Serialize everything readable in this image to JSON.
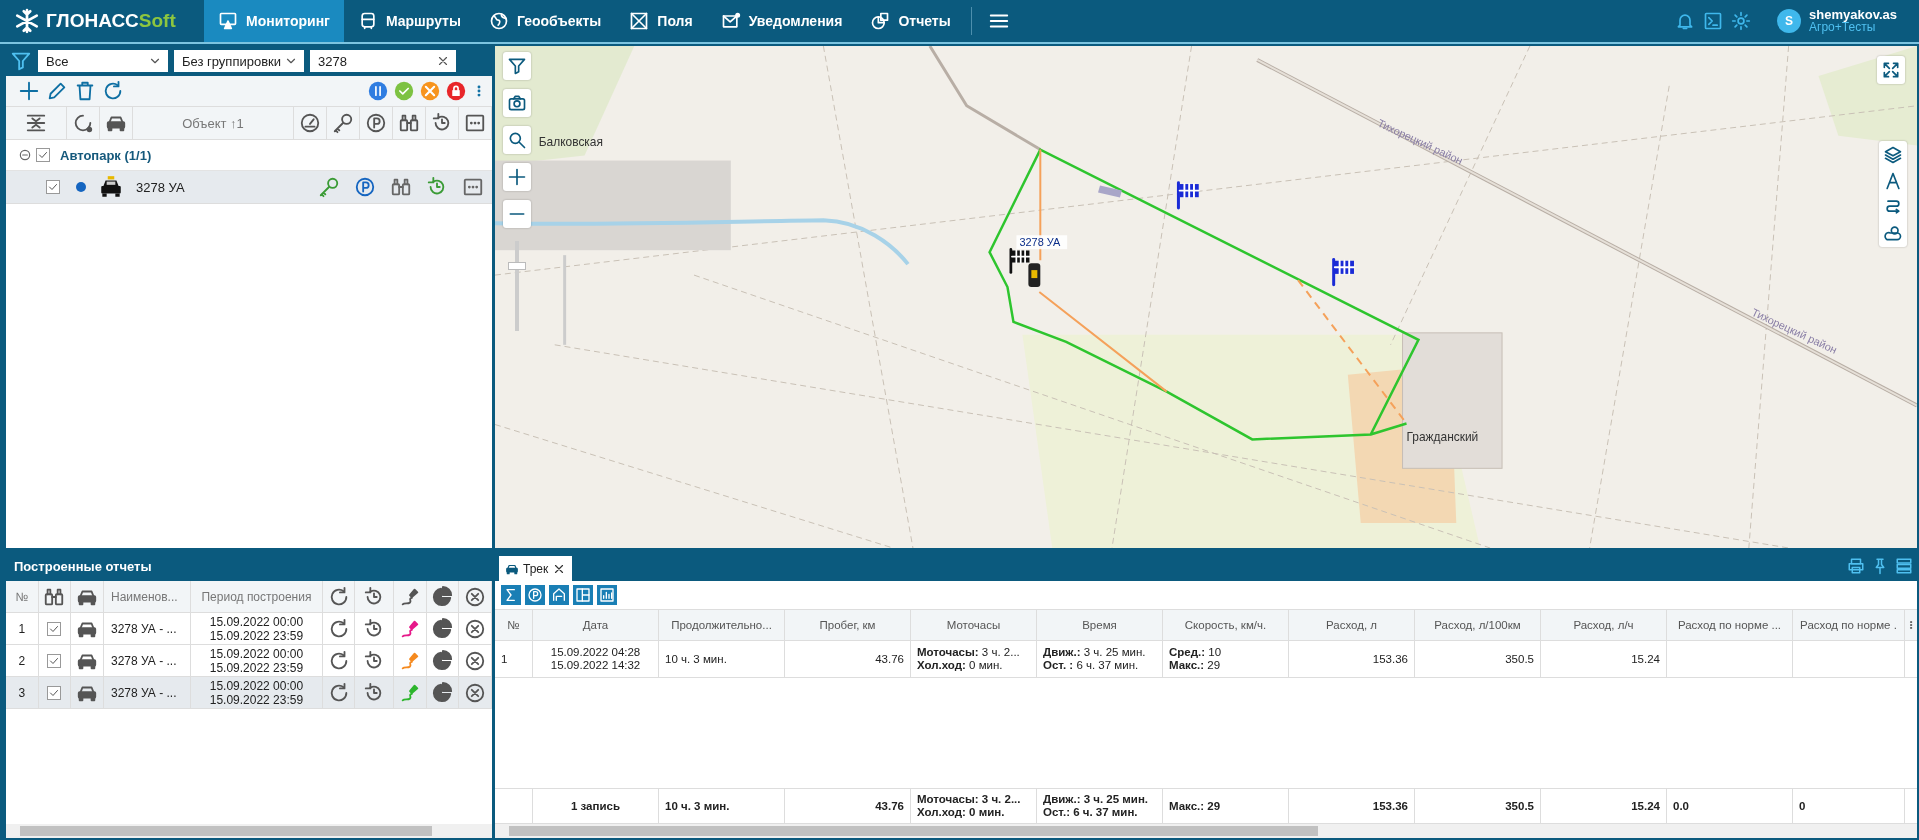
{
  "header": {
    "brand": "ГЛОНАСС",
    "brand_accent": "Soft",
    "nav": [
      {
        "label": "Мониторинг",
        "selected": true
      },
      {
        "label": "Маршруты",
        "selected": false
      },
      {
        "label": "Геообъекты",
        "selected": false
      },
      {
        "label": "Поля",
        "selected": false
      },
      {
        "label": "Уведомления",
        "selected": false
      },
      {
        "label": "Отчеты",
        "selected": false
      }
    ],
    "user": {
      "name": "shemyakov.as",
      "org": "Агро+Тесты",
      "avatar_letter": "S"
    }
  },
  "objects_panel": {
    "filters": [
      "Все",
      "Без группировки"
    ],
    "search": "3278",
    "column_label": "Объект ↑1",
    "groups": [
      {
        "name": "Автопарк",
        "count": "(1/1)",
        "expanded": true,
        "checked": true,
        "children": [
          {
            "name": "3278 УА",
            "checked": true,
            "selected": true,
            "color": "#1565c0"
          }
        ]
      }
    ]
  },
  "map": {
    "zoom_slider": {
      "level": 0.75
    },
    "labels": [
      "Балковская",
      "Тихорецкий район",
      "Тихорецкий район",
      "Гражданский"
    ],
    "vehicle_label": "3278 УА"
  },
  "reports_panel": {
    "title": "Построенные отчеты",
    "columns": [
      "№",
      "Наименов...",
      "Период построения"
    ],
    "rows": [
      {
        "num": "1",
        "checked": true,
        "name": "3278 УА - ...",
        "period": [
          "15.09.2022 00:00",
          "15.09.2022 23:59"
        ],
        "color": "#e6198a",
        "selected": false
      },
      {
        "num": "2",
        "checked": true,
        "name": "3278 УА - ...",
        "period": [
          "15.09.2022 00:00",
          "15.09.2022 23:59"
        ],
        "color": "#f58a1f",
        "selected": false
      },
      {
        "num": "3",
        "checked": true,
        "name": "3278 УА - ...",
        "period": [
          "15.09.2022 00:00",
          "15.09.2022 23:59"
        ],
        "color": "#2db52d",
        "selected": true
      }
    ]
  },
  "track_panel": {
    "tabs": [
      {
        "label": "Трек",
        "selected": true
      }
    ],
    "columns": [
      "№",
      "Дата",
      "Продолжительно...",
      "Пробег, км",
      "Моточасы",
      "Время",
      "Скорость, км/ч.",
      "Расход, л",
      "Расход, л/100км",
      "Расход, л/ч",
      "Расход по норме ...",
      "Расход по норме ."
    ],
    "rows": [
      {
        "cells": [
          [
            "1"
          ],
          [
            "15.09.2022 04:28",
            "15.09.2022 14:32"
          ],
          [
            "10 ч. 3 мин."
          ],
          [
            "43.76"
          ],
          [
            "**Моточасы:** 3 ч. 2...",
            "**Хол.ход:** 0 мин."
          ],
          [
            "**Движ.:** 3 ч. 25 мин.",
            "**Ост. :** 6 ч. 37 мин."
          ],
          [
            "**Сред.:** 10",
            "**Макс.:** 29"
          ],
          [
            "153.36"
          ],
          [
            "350.5"
          ],
          [
            "15.24"
          ]
        ]
      }
    ],
    "footer": {
      "cells": [
        [
          "1 запись"
        ],
        [
          "10 ч. 3 мин."
        ],
        [
          "43.76"
        ],
        [
          "Моточасы: 3 ч. 2...",
          "Хол.ход: 0 мин."
        ],
        [
          "Движ.: 3 ч. 25 мин.",
          "Ост.: 6 ч. 37 мин."
        ],
        [
          "Макс.: 29"
        ],
        [
          "153.36"
        ],
        [
          "350.5"
        ],
        [
          "15.24"
        ],
        [
          "0.0"
        ],
        [
          "0"
        ]
      ]
    }
  }
}
